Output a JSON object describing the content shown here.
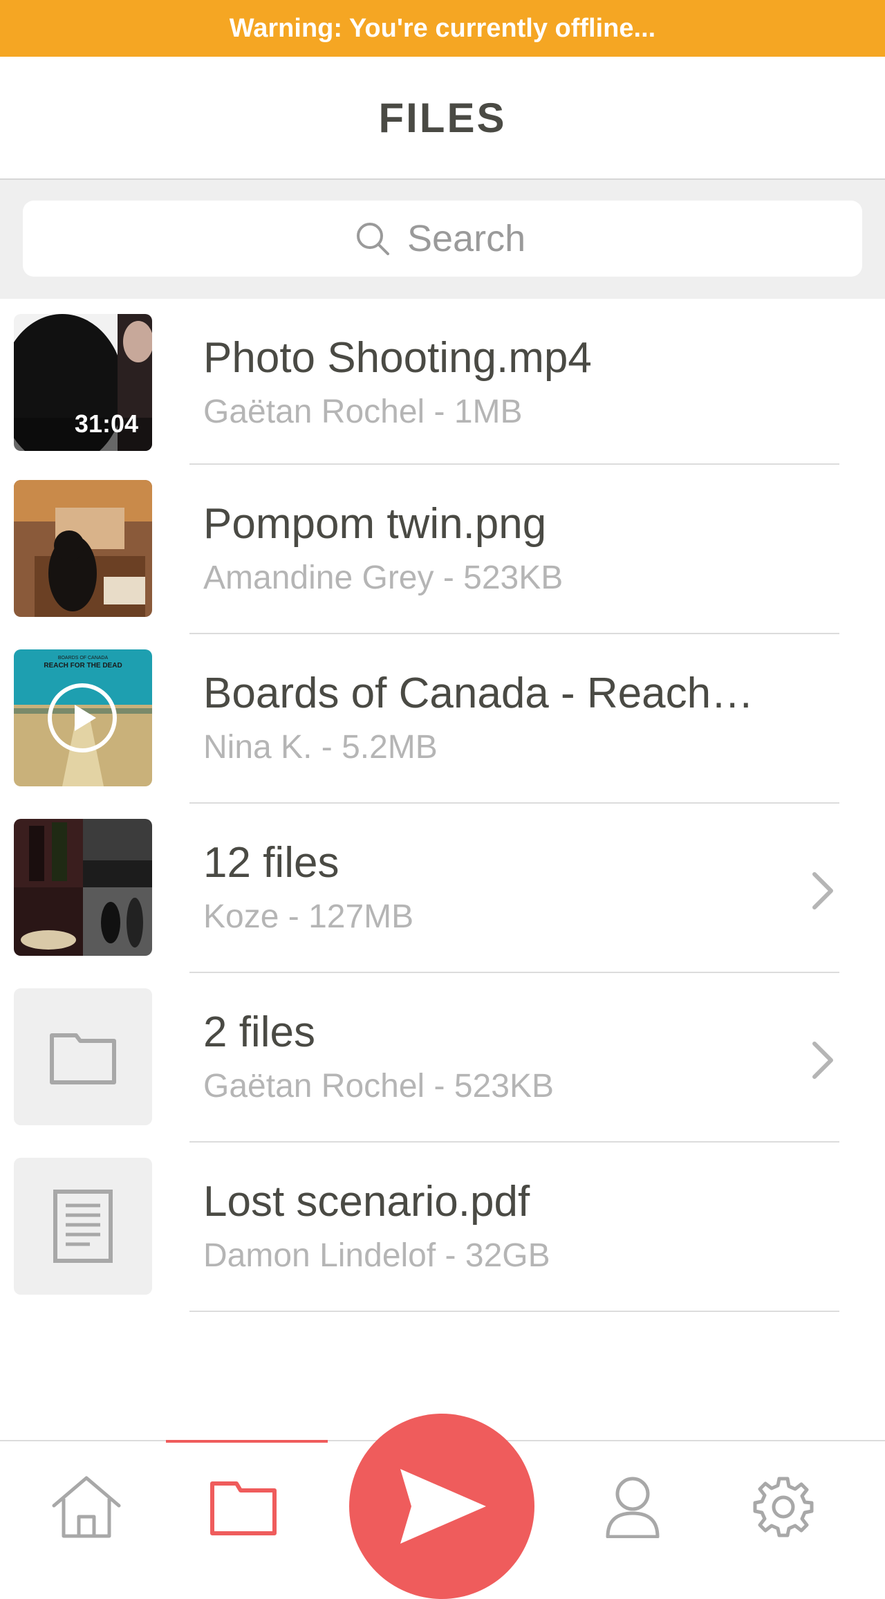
{
  "banner": {
    "text": "Warning: You're currently offline..."
  },
  "header": {
    "title": "FILES"
  },
  "search": {
    "placeholder": "Search"
  },
  "files": [
    {
      "name": "Photo Shooting.mp4",
      "meta": "Gaëtan Rochel - 1MB",
      "duration": "31:04"
    },
    {
      "name": "Pompom twin.png",
      "meta": "Amandine Grey - 523KB"
    },
    {
      "name": "Boards of Canada - Reach…",
      "meta": "Nina K. - 5.2MB",
      "album_title": "REACH FOR THE DEAD",
      "album_artist": "BOARDS OF CANADA"
    },
    {
      "name": "12 files",
      "meta": "Koze - 127MB"
    },
    {
      "name": "2 files",
      "meta": "Gaëtan Rochel - 523KB"
    },
    {
      "name": "Lost scenario.pdf",
      "meta": "Damon Lindelof - 32GB"
    }
  ],
  "tabbar": {
    "items": [
      "home-icon",
      "folder-icon",
      "send-icon",
      "user-icon",
      "gear-icon"
    ],
    "active": "folder-icon"
  },
  "colors": {
    "banner": "#f5a623",
    "accent": "#ef5c5c",
    "text": "#4a4a44",
    "meta": "#b5b5b5"
  }
}
